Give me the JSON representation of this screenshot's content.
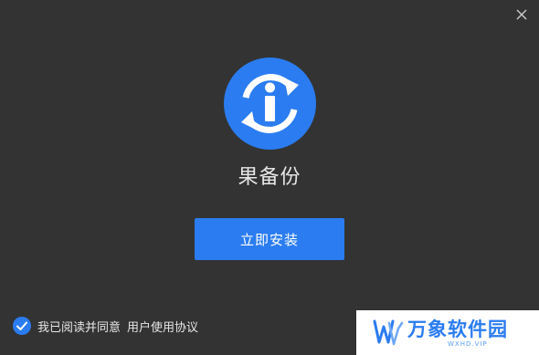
{
  "app": {
    "name": "果备份"
  },
  "main": {
    "install_label": "立即安装"
  },
  "footer": {
    "agreement_prefix": "我已阅读并同意",
    "agreement_link": "用户使用协议",
    "agreement_checked": true
  },
  "watermark": {
    "name": "万象软件园",
    "domain": "WXHD.VIP"
  },
  "colors": {
    "background": "#333333",
    "accent": "#2b7cf0",
    "text": "#e6e6e6"
  },
  "icons": {
    "close": "close-icon",
    "logo": "app-logo-icon",
    "check": "checkbox-checked-icon"
  }
}
